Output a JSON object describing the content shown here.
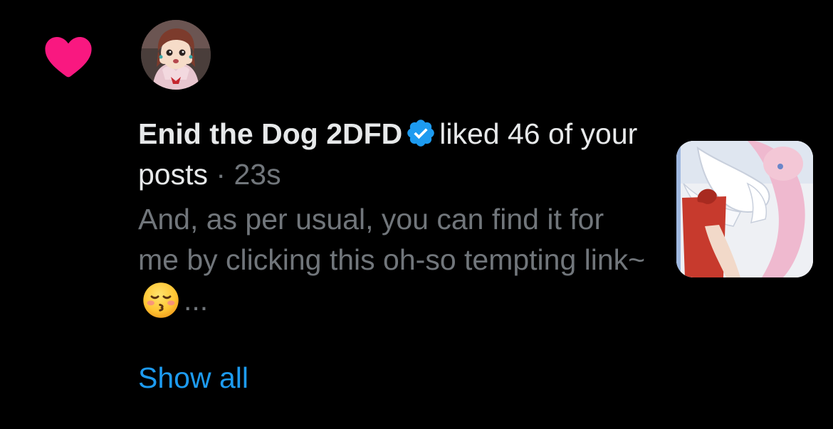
{
  "notification": {
    "type_icon": "heart-icon",
    "user_name": "Enid the Dog 2DFD",
    "verified_icon": "verified-badge-icon",
    "action_text": "liked 46 of your posts",
    "separator": "·",
    "time_ago": "23s",
    "preview_text": "And, as per usual, you can find it for me by clicking this oh-so tempting link~",
    "preview_emoji": "kissing-face-with-closed-eyes-emoji",
    "preview_ellipsis": "...",
    "show_all_label": "Show all",
    "thumbnail": "post-thumbnail"
  },
  "colors": {
    "background": "#000000",
    "heart": "#f91880",
    "primary_text": "#e7e9ea",
    "secondary_text": "#71767b",
    "link": "#1d9bf0",
    "verified": "#1d9bf0"
  }
}
